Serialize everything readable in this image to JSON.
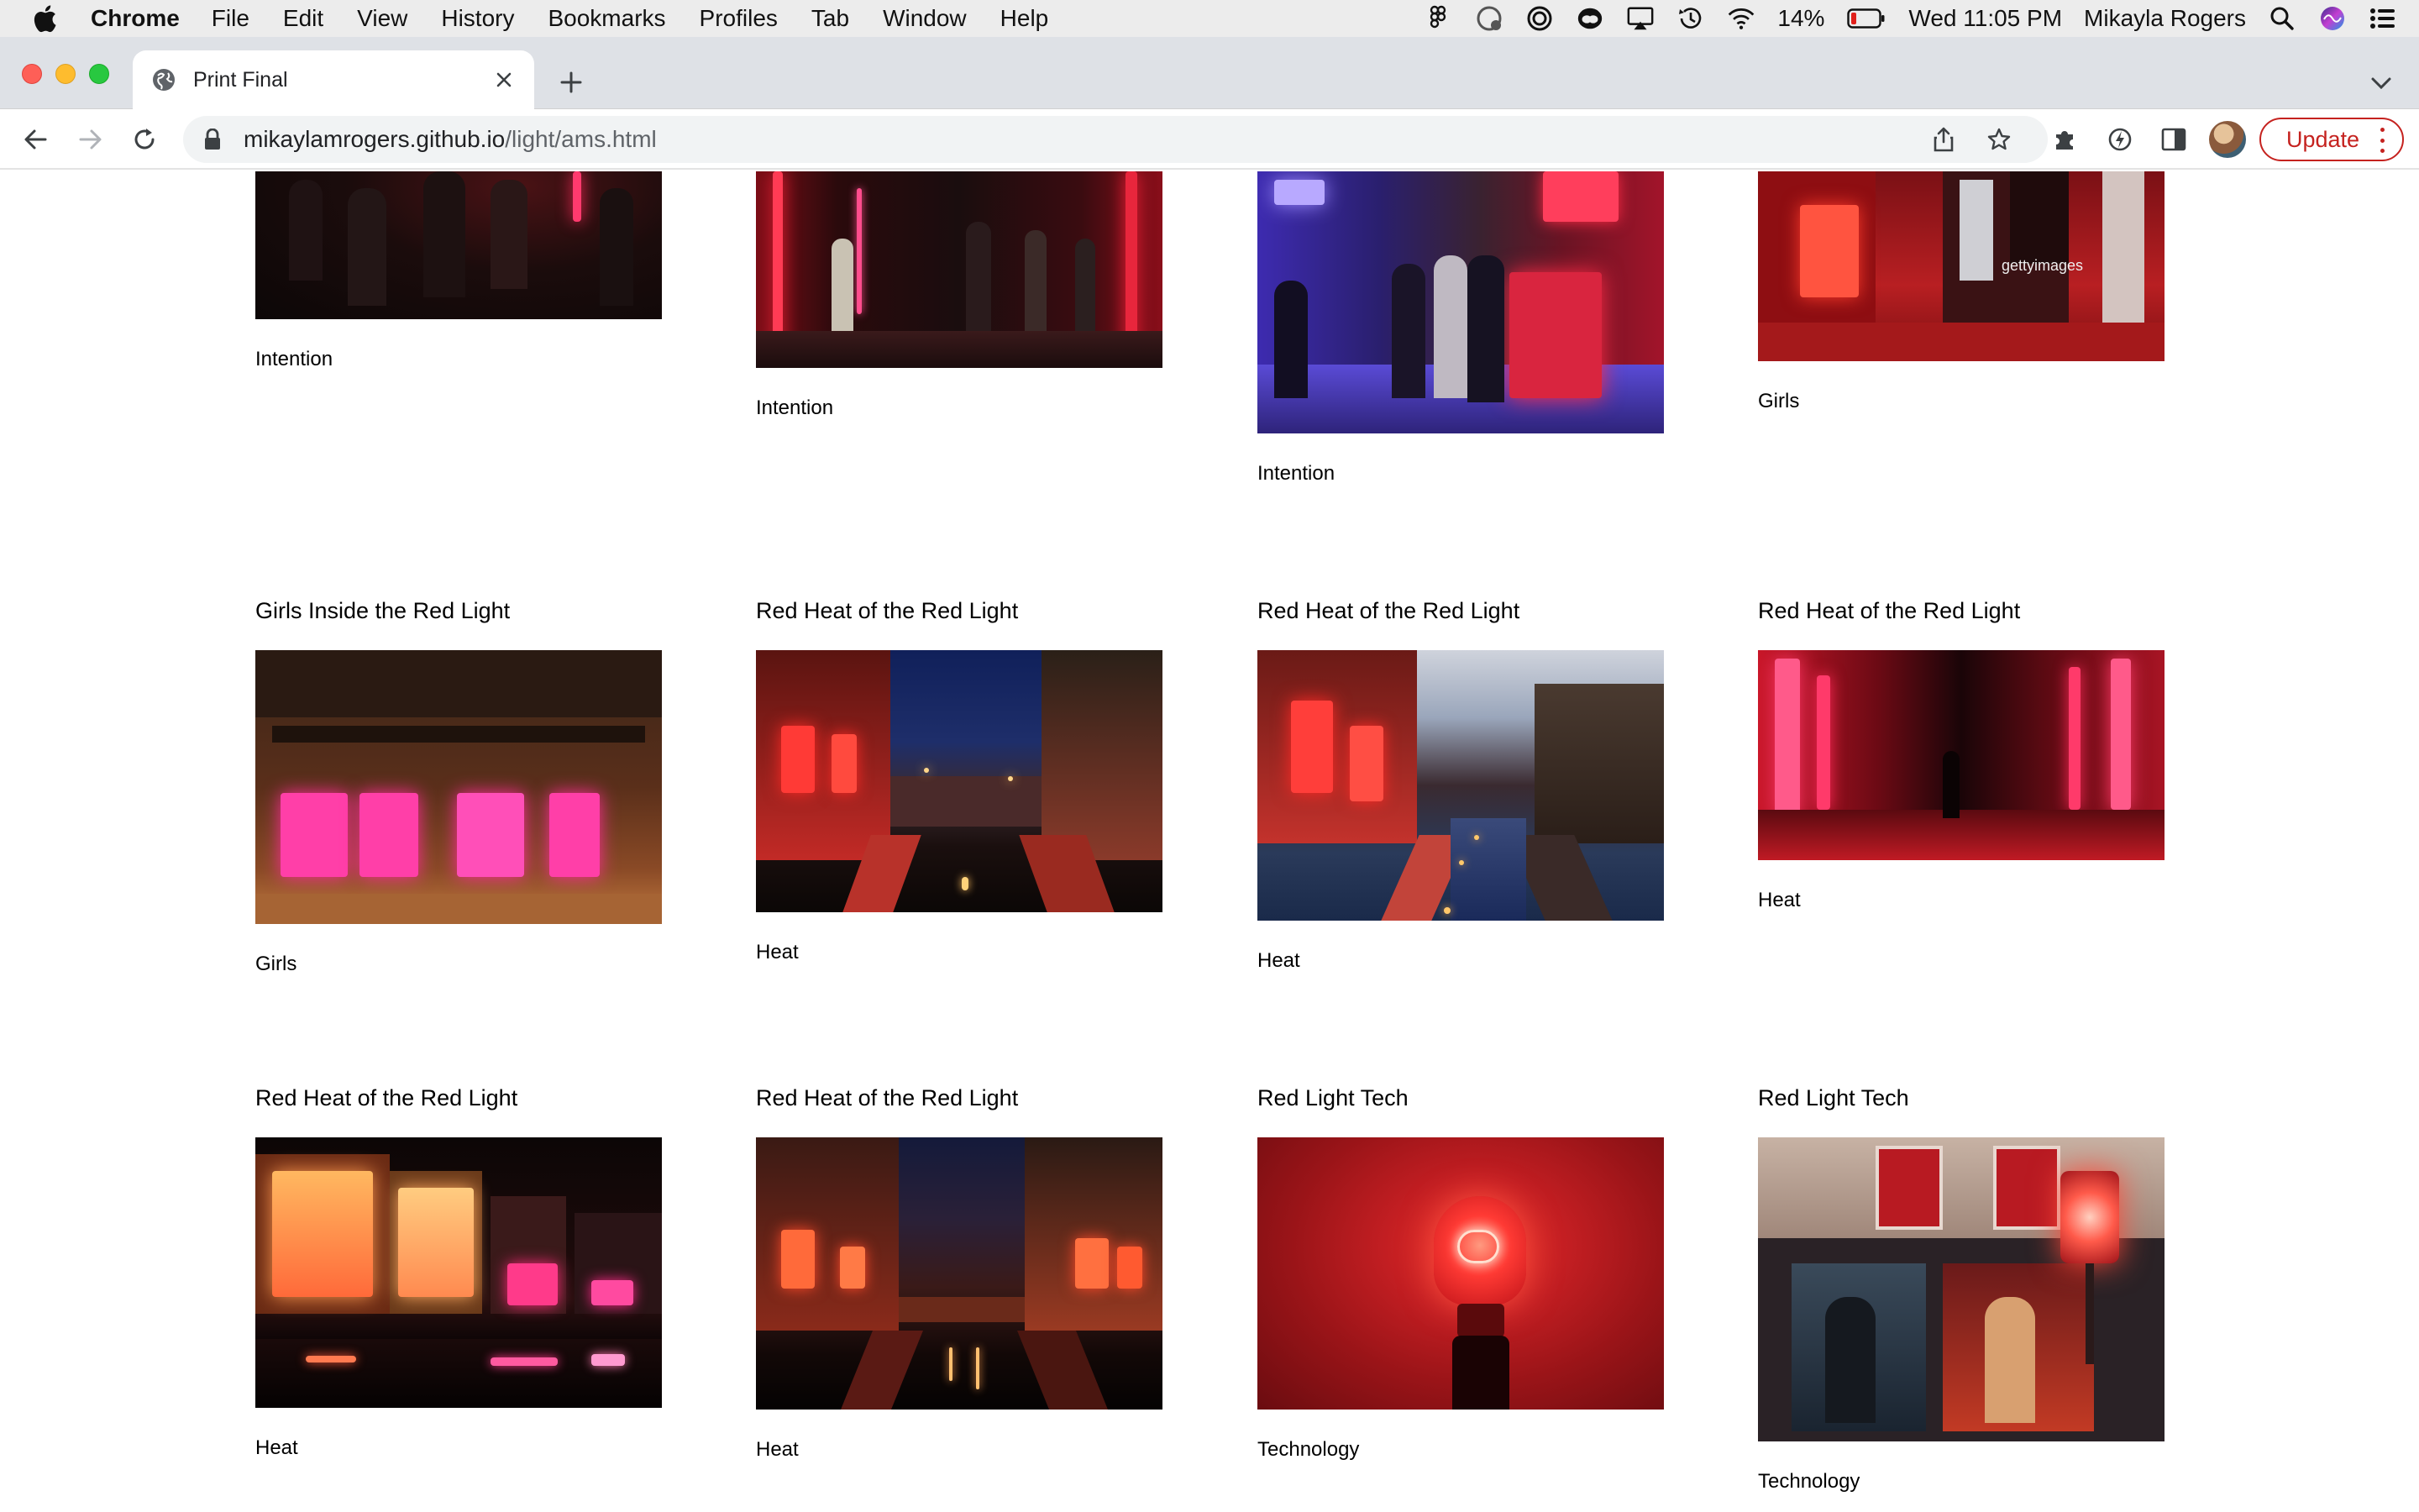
{
  "menubar": {
    "app_name": "Chrome",
    "menus": [
      "File",
      "Edit",
      "View",
      "History",
      "Bookmarks",
      "Profiles",
      "Tab",
      "Window",
      "Help"
    ],
    "battery": "14%",
    "datetime": "Wed 11:05 PM",
    "user": "Mikayla Rogers"
  },
  "tab": {
    "title": "Print Final"
  },
  "omnibox": {
    "host": "mikaylamrogers.github.io",
    "path": "/light/ams.html"
  },
  "toolbar": {
    "update_label": "Update"
  },
  "gallery": {
    "row1": [
      {
        "caption": "Intention"
      },
      {
        "caption": "Intention"
      },
      {
        "caption": "Intention"
      },
      {
        "caption": "Girls",
        "watermark": "gettyimages"
      }
    ],
    "row2": [
      {
        "heading": "Girls Inside the Red Light",
        "caption": "Girls"
      },
      {
        "heading": "Red Heat of the Red Light",
        "caption": "Heat"
      },
      {
        "heading": "Red Heat of the Red Light",
        "caption": "Heat"
      },
      {
        "heading": "Red Heat of the Red Light",
        "caption": "Heat"
      }
    ],
    "row3": [
      {
        "heading": "Red Heat of the Red Light",
        "caption": "Heat"
      },
      {
        "heading": "Red Heat of the Red Light",
        "caption": "Heat"
      },
      {
        "heading": "Red Light Tech",
        "caption": "Technology"
      },
      {
        "heading": "Red Light Tech",
        "caption": "Technology"
      }
    ]
  },
  "colors": {
    "update_red": "#c5221f",
    "tabstrip_bg": "#dee1e6",
    "omnibox_bg": "#f1f3f4"
  }
}
